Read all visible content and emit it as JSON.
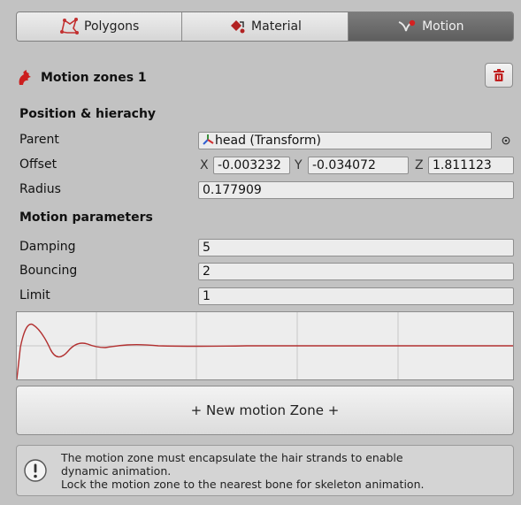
{
  "tabs": [
    {
      "label": "Polygons",
      "icon": "polygon-icon",
      "active": false
    },
    {
      "label": "Material",
      "icon": "material-icon",
      "active": false
    },
    {
      "label": "Motion",
      "icon": "motion-icon",
      "active": true
    }
  ],
  "zone": {
    "title": "Motion zones 1"
  },
  "position": {
    "title": "Position & hierachy",
    "parent_label": "Parent",
    "parent_value": "head (Transform)",
    "offset_label": "Offset",
    "offset": {
      "x_label": "X",
      "x": "-0.003232",
      "y_label": "Y",
      "y": "-0.034072",
      "z_label": "Z",
      "z": "1.811123"
    },
    "radius_label": "Radius",
    "radius_value": "0.177909"
  },
  "motion": {
    "title": "Motion parameters",
    "damping_label": "Damping",
    "damping_value": "5",
    "bouncing_label": "Bouncing",
    "bouncing_value": "2",
    "limit_label": "Limit",
    "limit_value": "1"
  },
  "new_zone_button": "+ New motion Zone +",
  "help": {
    "lines": [
      "The motion zone must encapsulate the hair strands to enable",
      "dynamic animation.",
      "Lock the motion zone to the nearest bone for skeleton animation."
    ]
  },
  "colors": {
    "curve": "#b23030",
    "accent": "#cc1f1f"
  }
}
